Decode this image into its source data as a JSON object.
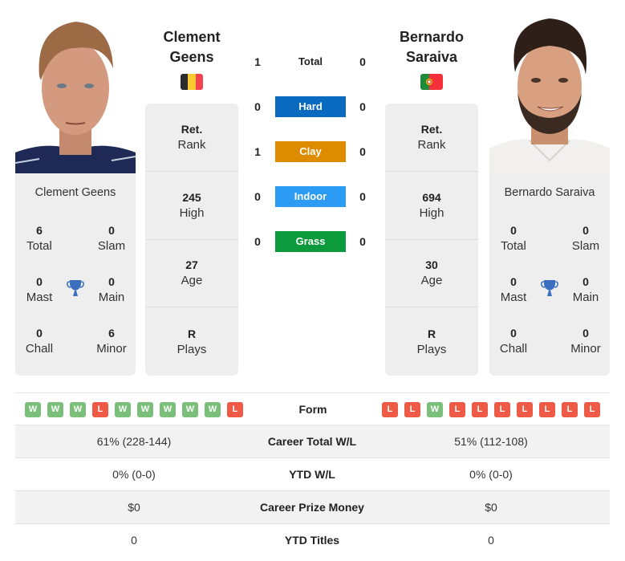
{
  "player1": {
    "name": "Clement Geens",
    "name_line1": "Clement",
    "name_line2": "Geens",
    "country": "Belgium",
    "flag_colors": [
      "#2b2b2b",
      "#f9c932",
      "#f2434f"
    ],
    "info": [
      {
        "value": "Ret.",
        "label": "Rank"
      },
      {
        "value": "245",
        "label": "High"
      },
      {
        "value": "27",
        "label": "Age"
      },
      {
        "value": "R",
        "label": "Plays"
      }
    ],
    "titles": {
      "total": {
        "value": "6",
        "label": "Total"
      },
      "slam": {
        "value": "0",
        "label": "Slam"
      },
      "mast": {
        "value": "0",
        "label": "Mast"
      },
      "main": {
        "value": "0",
        "label": "Main"
      },
      "chall": {
        "value": "0",
        "label": "Chall"
      },
      "minor": {
        "value": "6",
        "label": "Minor"
      }
    },
    "form": [
      "W",
      "W",
      "W",
      "L",
      "W",
      "W",
      "W",
      "W",
      "W",
      "L"
    ]
  },
  "player2": {
    "name": "Bernardo Saraiva",
    "name_line1": "Bernardo",
    "name_line2": "Saraiva",
    "country": "Portugal",
    "flag_colors": [
      "#1f8a3a",
      "#f4303a"
    ],
    "info": [
      {
        "value": "Ret.",
        "label": "Rank"
      },
      {
        "value": "694",
        "label": "High"
      },
      {
        "value": "30",
        "label": "Age"
      },
      {
        "value": "R",
        "label": "Plays"
      }
    ],
    "titles": {
      "total": {
        "value": "0",
        "label": "Total"
      },
      "slam": {
        "value": "0",
        "label": "Slam"
      },
      "mast": {
        "value": "0",
        "label": "Mast"
      },
      "main": {
        "value": "0",
        "label": "Main"
      },
      "chall": {
        "value": "0",
        "label": "Chall"
      },
      "minor": {
        "value": "0",
        "label": "Minor"
      }
    },
    "form": [
      "L",
      "L",
      "W",
      "L",
      "L",
      "L",
      "L",
      "L",
      "L",
      "L"
    ]
  },
  "h2h": [
    {
      "surface": "Total",
      "p1": "1",
      "p2": "0",
      "color": "transparent"
    },
    {
      "surface": "Hard",
      "p1": "0",
      "p2": "0",
      "color": "#0a6abf"
    },
    {
      "surface": "Clay",
      "p1": "1",
      "p2": "0",
      "color": "#dd8c00"
    },
    {
      "surface": "Indoor",
      "p1": "0",
      "p2": "0",
      "color": "#2b9bf4"
    },
    {
      "surface": "Grass",
      "p1": "0",
      "p2": "0",
      "color": "#0c9a3c"
    }
  ],
  "form_label": "Form",
  "stats": [
    {
      "label": "Career Total W/L",
      "p1": "61% (228-144)",
      "p2": "51% (112-108)"
    },
    {
      "label": "YTD W/L",
      "p1": "0% (0-0)",
      "p2": "0% (0-0)"
    },
    {
      "label": "Career Prize Money",
      "p1": "$0",
      "p2": "$0"
    },
    {
      "label": "YTD Titles",
      "p1": "0",
      "p2": "0"
    }
  ],
  "colors": {
    "win": "#7abf7a",
    "loss": "#ee5a45",
    "trophy": "#3a6fbf",
    "card_bg": "#eeeeee"
  }
}
